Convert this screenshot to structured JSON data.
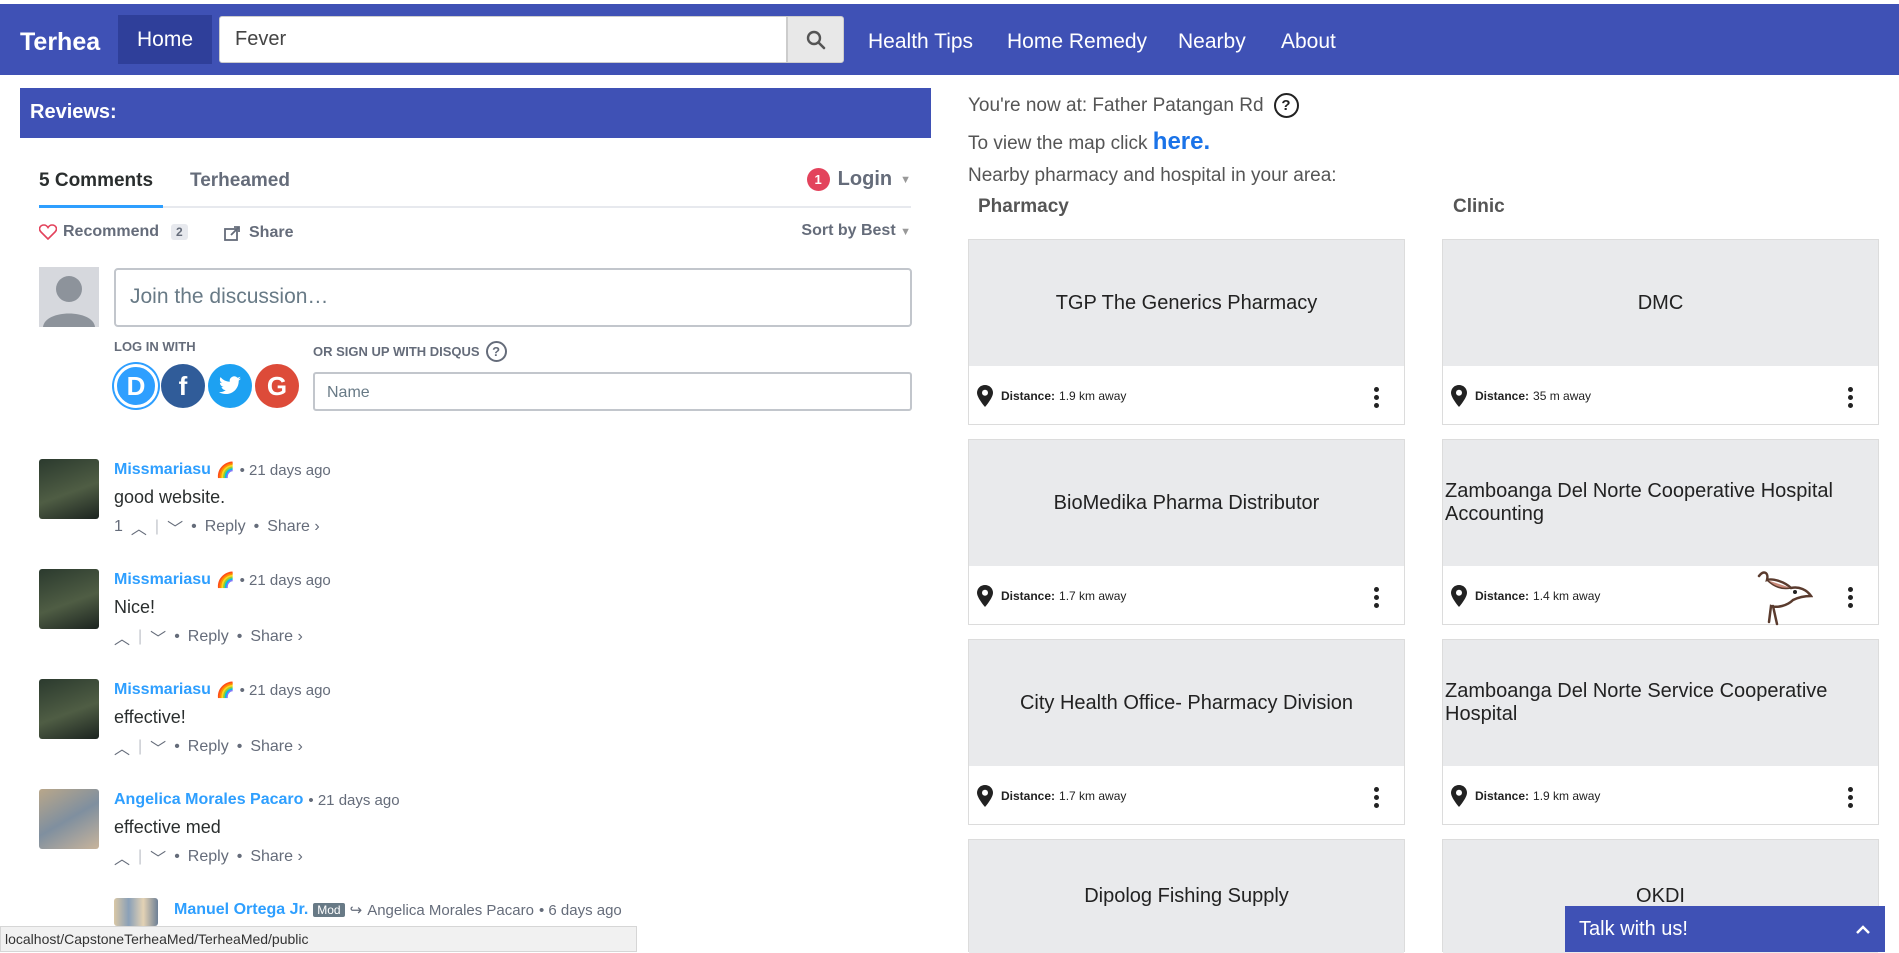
{
  "navbar": {
    "brand": "Terhea",
    "home": "Home",
    "search_value": "Fever",
    "links": [
      "Health Tips",
      "Home Remedy",
      "Nearby",
      "About"
    ]
  },
  "reviews": {
    "header": "Reviews:",
    "tab_comments": "5 Comments",
    "tab_site": "Terheamed",
    "login_badge": "1",
    "login_label": "Login",
    "recommend_label": "Recommend",
    "recommend_count": "2",
    "share_label": "Share",
    "sort_label": "Sort by Best",
    "join_placeholder": "Join the discussion…",
    "login_with": "LOG IN WITH",
    "signup_label": "OR SIGN UP WITH DISQUS",
    "name_placeholder": "Name",
    "social": [
      "D",
      "f",
      "",
      "G"
    ]
  },
  "comments": [
    {
      "user": "Missmariasu",
      "emoji": "🌈",
      "time": "• 21 days ago",
      "text": "good website.",
      "votes": "1",
      "reply": "Reply",
      "share": "Share ›"
    },
    {
      "user": "Missmariasu",
      "emoji": "🌈",
      "time": "• 21 days ago",
      "text": "Nice!",
      "votes": "",
      "reply": "Reply",
      "share": "Share ›"
    },
    {
      "user": "Missmariasu",
      "emoji": "🌈",
      "time": "• 21 days ago",
      "text": "effective!",
      "votes": "",
      "reply": "Reply",
      "share": "Share ›"
    },
    {
      "user": "Angelica Morales Pacaro",
      "emoji": "",
      "time": "• 21 days ago",
      "text": "effective med",
      "votes": "",
      "reply": "Reply",
      "share": "Share ›"
    },
    {
      "user": "Manuel Ortega Jr.",
      "badge": "Mod",
      "reply_to": "Angelica Morales Pacaro",
      "time": "• 6 days ago"
    }
  ],
  "status_url": "localhost/CapstoneTerheaMed/TerheaMed/public",
  "location": {
    "now_at": "You're now at: Father Patangan Rd",
    "map_text": "To view the map click",
    "map_link": "here.",
    "nearby_text": "Nearby pharmacy and hospital in your area:"
  },
  "columns": {
    "pharmacy": "Pharmacy",
    "clinic": "Clinic"
  },
  "distance_label": "Distance:",
  "pharmacies": [
    {
      "name": "TGP The Generics Pharmacy",
      "distance": "1.9 km away"
    },
    {
      "name": "BioMedika Pharma Distributor",
      "distance": "1.7 km away"
    },
    {
      "name": "City Health Office- Pharmacy Division",
      "distance": "1.7 km away"
    },
    {
      "name": "Dipolog Fishing Supply",
      "distance": ""
    }
  ],
  "clinics": [
    {
      "name": "DMC",
      "distance": "35 m away"
    },
    {
      "name": "Zamboanga Del Norte Cooperative Hospital Accounting",
      "distance": "1.4 km away"
    },
    {
      "name": "Zamboanga Del Norte Service Cooperative Hospital",
      "distance": "1.9 km away"
    },
    {
      "name": "OKDI",
      "distance": ""
    }
  ],
  "chat": {
    "label": "Talk with us!"
  },
  "colors": {
    "primary": "#3f51b5",
    "primary_dark": "#2f3f9a",
    "link": "#2e9fff",
    "badge": "#e3435c"
  }
}
